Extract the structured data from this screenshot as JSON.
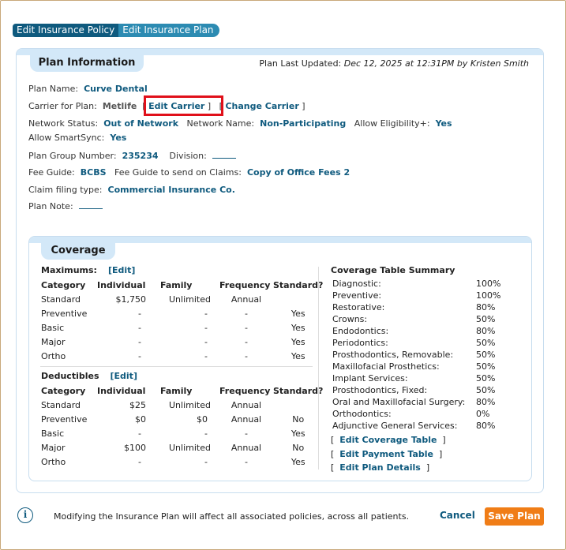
{
  "tabs": [
    {
      "label": "Edit Insurance Policy"
    },
    {
      "label": "Edit Insurance Plan"
    }
  ],
  "plan": {
    "section_title": "Plan Information",
    "last_updated_label": "Plan Last Updated:",
    "last_updated_value": "Dec 12, 2025 at 12:31PM by Kristen Smith",
    "plan_name_label": "Plan Name:",
    "plan_name": "Curve Dental",
    "carrier_label": "Carrier for Plan:",
    "carrier": "Metlife",
    "edit_carrier": "Edit Carrier",
    "change_carrier": "Change Carrier",
    "network_status_label": "Network Status:",
    "network_status": "Out of Network",
    "network_name_label": "Network Name:",
    "network_name": "Non-Participating",
    "allow_elig_label": "Allow Eligibility+:",
    "allow_elig": "Yes",
    "allow_smartsync_label": "Allow SmartSync:",
    "allow_smartsync": "Yes",
    "group_number_label": "Plan Group Number:",
    "group_number": "235234",
    "division_label": "Division:",
    "fee_guide_label": "Fee Guide:",
    "fee_guide": "BCBS",
    "fee_guide_claims_label": "Fee Guide to send on Claims:",
    "fee_guide_claims": "Copy of Office Fees 2",
    "claim_type_label": "Claim filing type:",
    "claim_type": "Commercial Insurance Co.",
    "plan_note_label": "Plan Note:"
  },
  "coverage": {
    "section_title": "Coverage",
    "maximums_label": "Maximums:",
    "deductibles_label": "Deductibles",
    "edit_label": "[Edit]",
    "headers": [
      "Category",
      "Individual",
      "Family",
      "Frequency",
      "Standard?"
    ],
    "maximums": [
      [
        "Standard",
        "$1,750",
        "Unlimited",
        "Annual",
        ""
      ],
      [
        "Preventive",
        "-",
        "-",
        "-",
        "Yes"
      ],
      [
        "Basic",
        "-",
        "-",
        "-",
        "Yes"
      ],
      [
        "Major",
        "-",
        "-",
        "-",
        "Yes"
      ],
      [
        "Ortho",
        "-",
        "-",
        "-",
        "Yes"
      ]
    ],
    "deductibles": [
      [
        "Standard",
        "$25",
        "Unlimited",
        "Annual",
        ""
      ],
      [
        "Preventive",
        "$0",
        "$0",
        "Annual",
        "No"
      ],
      [
        "Basic",
        "-",
        "-",
        "-",
        "Yes"
      ],
      [
        "Major",
        "$100",
        "Unlimited",
        "Annual",
        "No"
      ],
      [
        "Ortho",
        "-",
        "-",
        "-",
        "Yes"
      ]
    ],
    "summary_title": "Coverage Table Summary",
    "summary": [
      [
        "Diagnostic:",
        "100%"
      ],
      [
        "Preventive:",
        "100%"
      ],
      [
        "Restorative:",
        "80%"
      ],
      [
        "Crowns:",
        "50%"
      ],
      [
        "Endodontics:",
        "80%"
      ],
      [
        "Periodontics:",
        "50%"
      ],
      [
        "Prosthodontics, Removable:",
        "50%"
      ],
      [
        "Maxillofacial Prosthetics:",
        "50%"
      ],
      [
        "Implant Services:",
        "50%"
      ],
      [
        "Prosthodontics, Fixed:",
        "50%"
      ],
      [
        "Oral and Maxillofacial Surgery:",
        "80%"
      ],
      [
        "Orthodontics:",
        "0%"
      ],
      [
        "Adjunctive General Services:",
        "80%"
      ]
    ],
    "links": [
      "Edit Coverage Table",
      "Edit Payment Table",
      "Edit Plan Details"
    ]
  },
  "footer": {
    "info_icon": "info-icon",
    "message": "Modifying the Insurance Plan will affect all associated policies, across all patients.",
    "cancel": "Cancel",
    "save": "Save Plan"
  }
}
